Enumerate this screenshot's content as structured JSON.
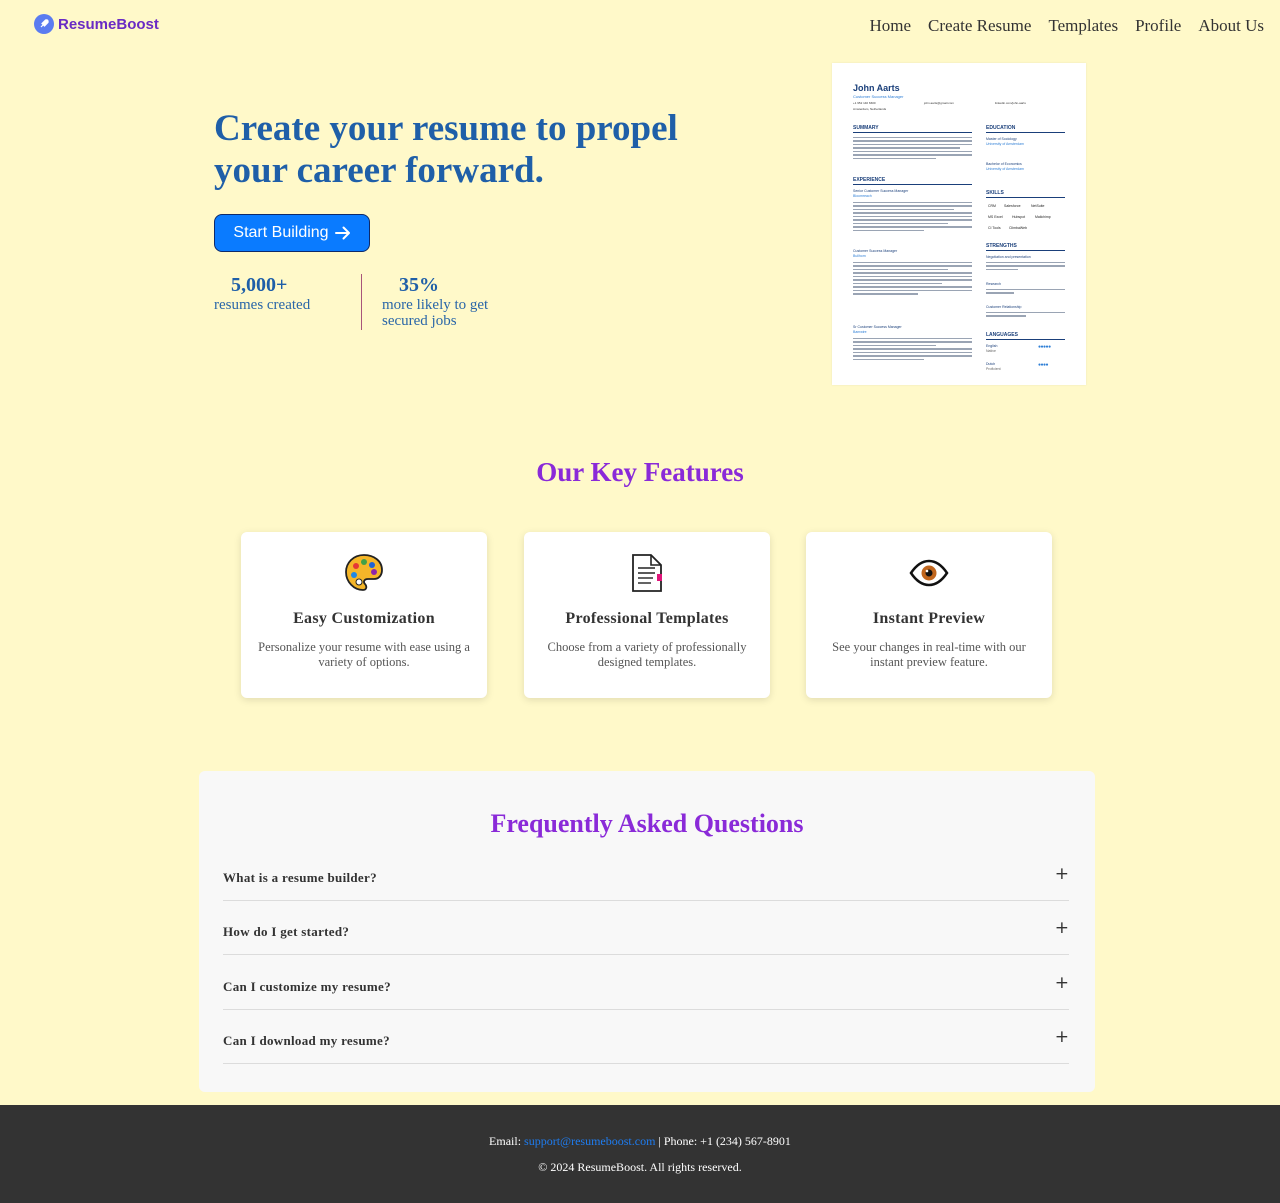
{
  "brand": {
    "name": "ResumeBoost",
    "accent": "#6a2bc4"
  },
  "nav": {
    "links": [
      "Home",
      "Create Resume",
      "Templates",
      "Profile",
      "About Us"
    ]
  },
  "hero": {
    "title_line1": "Create your resume to propel",
    "title_line2": "your career forward.",
    "cta_label": "Start Building",
    "cta_icon": "arrow-right-icon",
    "stats": [
      {
        "value": "5,000+",
        "label_line1": "resumes created",
        "label_line2": ""
      },
      {
        "value": "35%",
        "label_line1": "more likely to get",
        "label_line2": "secured jobs"
      }
    ]
  },
  "resume_preview": {
    "name": "John Aarts",
    "role": "Customer Success Manager",
    "phone": "+1 952 140 6600",
    "email": "john.aarts@gmail.com",
    "linkedin": "linkedin.com/john-aarts",
    "location": "Amsterdam, Netherlands",
    "sections": {
      "summary": "SUMMARY",
      "experience": "EXPERIENCE",
      "education": "EDUCATION",
      "skills": "SKILLS",
      "strengths": "STRENGTHS",
      "languages": "LANGUAGES"
    },
    "jobs": [
      "Senior Customer Success Manager",
      "Customer Success Manager",
      "Sr Customer Success Manager"
    ],
    "companies": [
      "Bloomreach",
      "Bullhorn",
      "Bamwire"
    ],
    "education": [
      "Master of Sociology",
      "Bachelor of Economics"
    ],
    "schools": [
      "University of Amsterdam",
      "University of Amsterdam"
    ],
    "skills": [
      "CRM",
      "Salesforce",
      "NetSuite",
      "MS Excel",
      "Hubspot",
      "Mailchimp",
      "CI Tools",
      "ClimbaWeb"
    ],
    "strengths": [
      "Negotiation and presentation",
      "Research",
      "Customer Relationship"
    ],
    "languages": [
      "English",
      "Dutch"
    ],
    "language_levels": [
      "Native",
      "Proficient"
    ]
  },
  "features": {
    "title": "Our Key Features",
    "cards": [
      {
        "icon": "palette-icon",
        "title": "Easy Customization",
        "desc": "Personalize your resume with ease using a variety of options."
      },
      {
        "icon": "document-icon",
        "title": "Professional Templates",
        "desc": "Choose from a variety of professionally designed templates."
      },
      {
        "icon": "eye-icon",
        "title": "Instant Preview",
        "desc": "See your changes in real-time with our instant preview feature."
      }
    ]
  },
  "faq": {
    "title": "Frequently Asked Questions",
    "items": [
      {
        "question": "What is a resume builder?",
        "toggle": "+"
      },
      {
        "question": "How do I get started?",
        "toggle": "+"
      },
      {
        "question": "Can I customize my resume?",
        "toggle": "+"
      },
      {
        "question": "Can I download my resume?",
        "toggle": "+"
      }
    ]
  },
  "footer": {
    "email_label": "Email:",
    "email": "support@resumeboost.com",
    "phone_label": "| Phone:",
    "phone": "+1 (234) 567-8901",
    "copyright": "© 2024 ResumeBoost. All rights reserved."
  }
}
